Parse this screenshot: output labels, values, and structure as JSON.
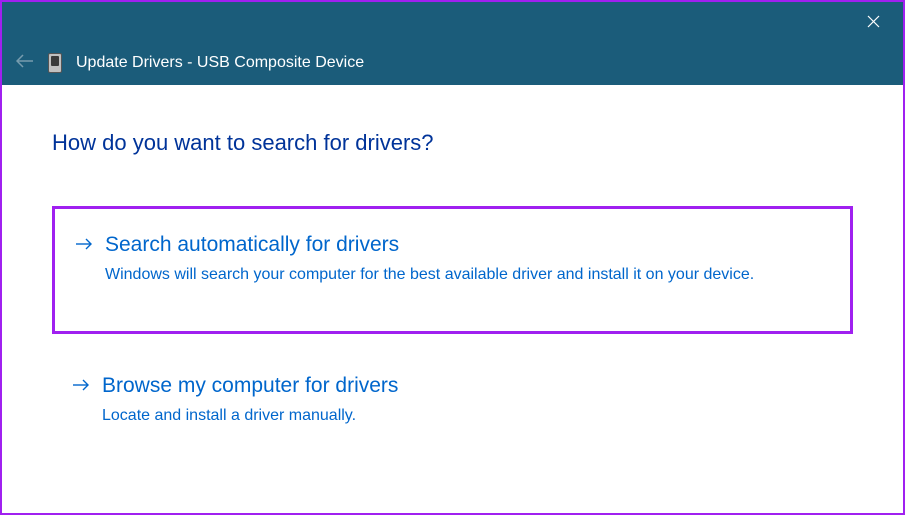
{
  "titlebar": {
    "close_aria": "Close"
  },
  "header": {
    "title": "Update Drivers - USB Composite Device"
  },
  "content": {
    "question": "How do you want to search for drivers?",
    "options": [
      {
        "title": "Search automatically for drivers",
        "description": "Windows will search your computer for the best available driver and install it on your device.",
        "highlighted": true
      },
      {
        "title": "Browse my computer for drivers",
        "description": "Locate and install a driver manually.",
        "highlighted": false
      }
    ]
  }
}
